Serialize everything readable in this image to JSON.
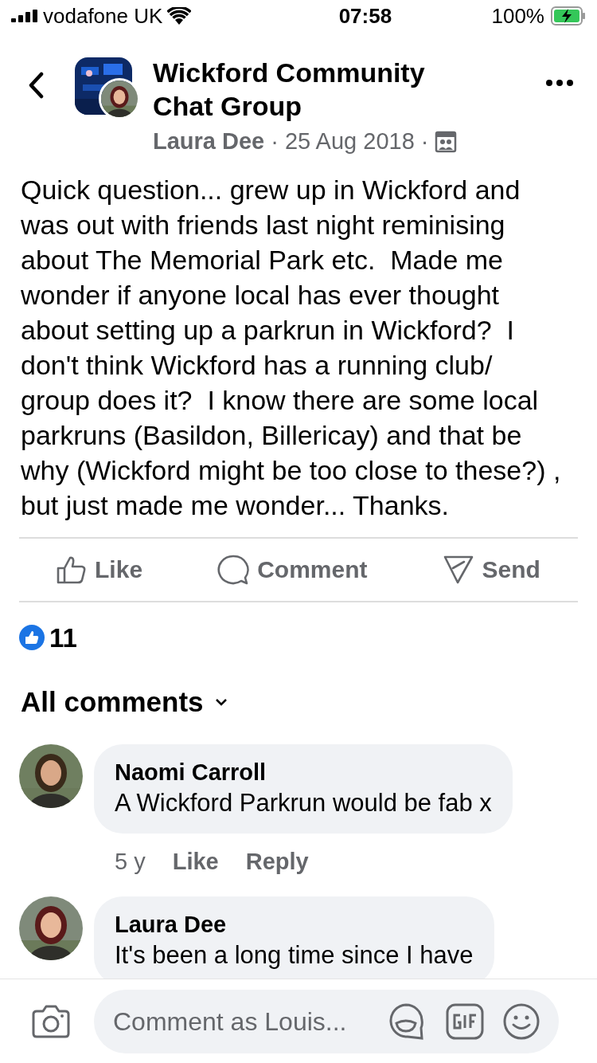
{
  "status_bar": {
    "carrier": "vodafone UK",
    "time": "07:58",
    "battery": "100%"
  },
  "header": {
    "group_name": "Wickford Community Chat Group",
    "author": "Laura Dee",
    "separator": "·",
    "date": "25 Aug 2018",
    "separator_2": "·"
  },
  "post": {
    "text": "Quick question... grew up in Wickford and was out with friends last night reminising about The Memorial Park etc.  Made me wonder if anyone local has ever thought about setting up a parkrun in Wickford?  I don't think Wickford has a running club/ group does it?  I know there are some local parkruns (Basildon, Billericay) and that be why (Wickford might be too close to these?) , but just made me wonder... Thanks."
  },
  "actions": [
    {
      "kind": "like",
      "label": "Like"
    },
    {
      "kind": "comment",
      "label": "Comment"
    },
    {
      "kind": "send",
      "label": "Send"
    }
  ],
  "reactions": {
    "count": "11"
  },
  "comments_header": {
    "label": "All comments"
  },
  "comments": [
    {
      "author": "Naomi Carroll",
      "text": "A Wickford Parkrun would be fab x",
      "time": "5 y",
      "like": "Like",
      "reply": "Reply"
    },
    {
      "author": "Laura Dee",
      "text": "It's been a long time since I have"
    }
  ],
  "composer": {
    "placeholder": "Comment as Louis..."
  }
}
